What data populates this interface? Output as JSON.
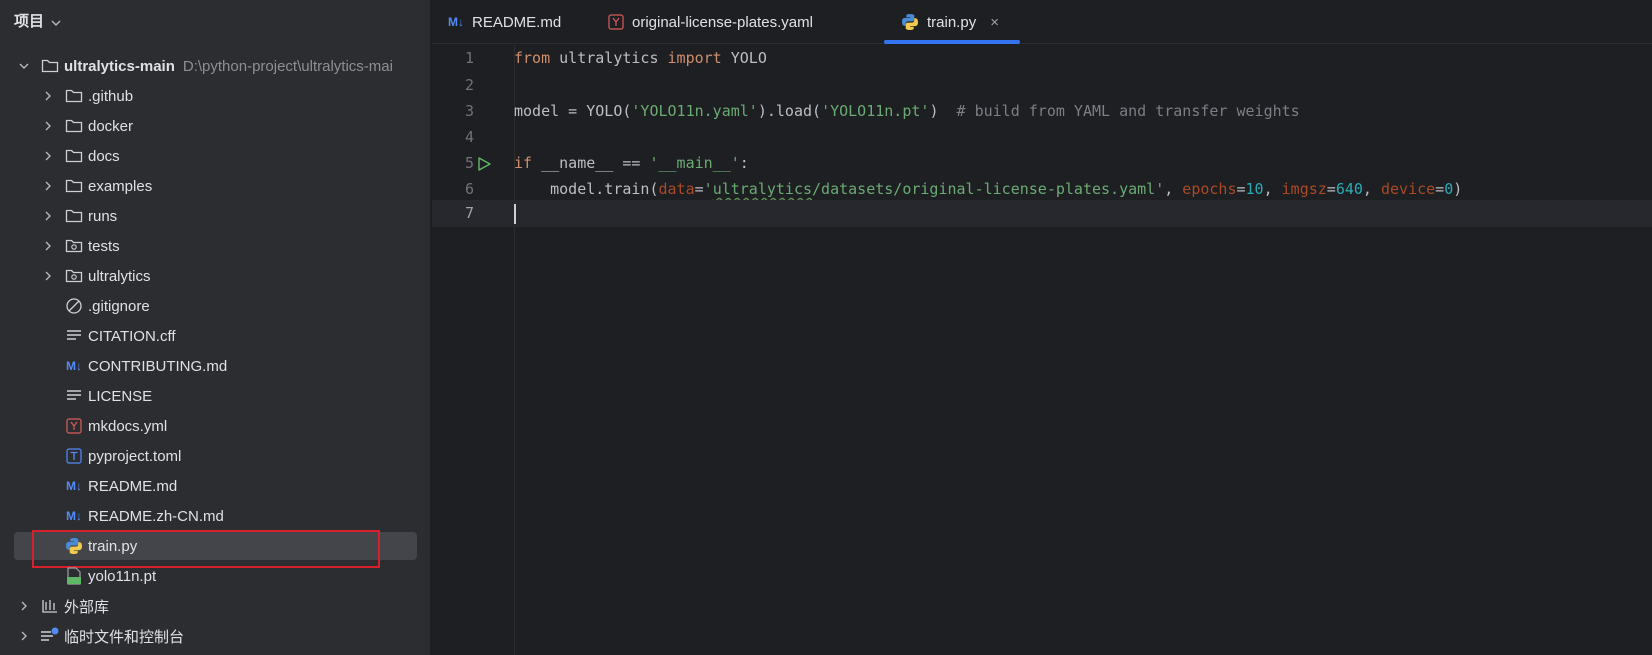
{
  "sidebar": {
    "title": "项目",
    "items": [
      {
        "label": "ultralytics-main",
        "path": "D:\\python-project\\ultralytics-mai",
        "type": "folder",
        "expanded": true
      },
      {
        "label": ".github",
        "type": "folder"
      },
      {
        "label": "docker",
        "type": "folder"
      },
      {
        "label": "docs",
        "type": "folder"
      },
      {
        "label": "examples",
        "type": "folder"
      },
      {
        "label": "runs",
        "type": "folder"
      },
      {
        "label": "tests",
        "type": "package-folder"
      },
      {
        "label": "ultralytics",
        "type": "package-folder"
      },
      {
        "label": ".gitignore",
        "type": "ignore-file"
      },
      {
        "label": "CITATION.cff",
        "type": "text-file"
      },
      {
        "label": "CONTRIBUTING.md",
        "type": "markdown-file"
      },
      {
        "label": "LICENSE",
        "type": "text-file"
      },
      {
        "label": "mkdocs.yml",
        "type": "yaml-file"
      },
      {
        "label": "pyproject.toml",
        "type": "toml-file"
      },
      {
        "label": "README.md",
        "type": "markdown-file"
      },
      {
        "label": "README.zh-CN.md",
        "type": "markdown-file"
      },
      {
        "label": "train.py",
        "type": "python-file",
        "selected": true
      },
      {
        "label": "yolo11n.pt",
        "type": "binary-file"
      },
      {
        "label": "外部库",
        "type": "library"
      },
      {
        "label": "临时文件和控制台",
        "type": "scratches"
      }
    ]
  },
  "tabs": [
    {
      "label": "README.md",
      "icon": "markdown-icon"
    },
    {
      "label": "original-license-plates.yaml",
      "icon": "yaml-icon"
    },
    {
      "label": "train.py",
      "icon": "python-icon",
      "active": true,
      "close": "×"
    }
  ],
  "editor": {
    "line_numbers": [
      "1",
      "2",
      "3",
      "4",
      "5",
      "6",
      "7"
    ],
    "current_line": 7,
    "lines": {
      "l1": {
        "kw1": "from",
        "t1": " ultralytics ",
        "kw2": "import",
        "t2": " YOLO"
      },
      "l3": {
        "t1": "model = YOLO(",
        "s1": "'YOLO11n.yaml'",
        "t2": ").load(",
        "s2": "'YOLO11n.pt'",
        "t3": ")  ",
        "c1": "# build from YAML and transfer weights"
      },
      "l5": {
        "kw1": "if",
        "t1": " __name__ == ",
        "s1": "'__main__'",
        "t2": ":"
      },
      "l6": {
        "t1": "    model.train(",
        "p1": "data",
        "t2": "=",
        "s1a": "'",
        "s1b": "ultralytics",
        "s1c": "/datasets/original-license-plates.yaml'",
        "t3": ", ",
        "p2": "epochs",
        "t4": "=",
        "n1": "10",
        "t5": ", ",
        "p3": "imgsz",
        "t6": "=",
        "n2": "640",
        "t7": ", ",
        "p4": "device",
        "t8": "=",
        "n3": "0",
        "t9": ")"
      }
    }
  },
  "colors": {
    "accent": "#3574f0",
    "selection_outline": "#d6202b",
    "keyword": "#cf8e6d",
    "string": "#6aab73",
    "comment": "#7a7e85",
    "number": "#2aacb8",
    "parameter": "#aa4926"
  }
}
